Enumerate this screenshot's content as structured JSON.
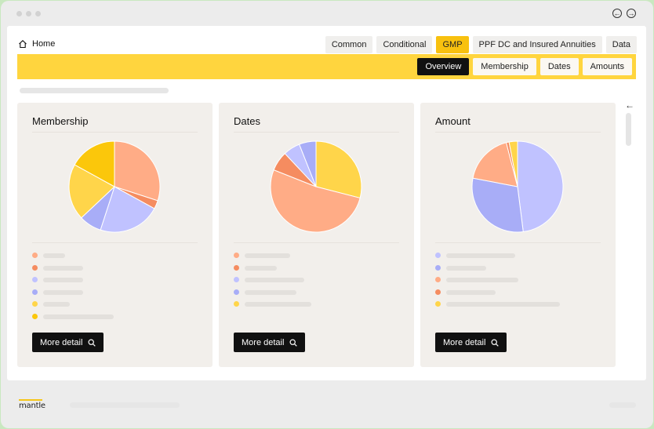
{
  "home": {
    "label": "Home"
  },
  "tabs": [
    {
      "label": "Common",
      "active": false
    },
    {
      "label": "Conditional",
      "active": false
    },
    {
      "label": "GMP",
      "active": true
    },
    {
      "label": "PPF DC and Insured Annuities",
      "active": false
    },
    {
      "label": "Data",
      "active": false
    }
  ],
  "subtabs": [
    {
      "label": "Overview",
      "active": true
    },
    {
      "label": "Membership",
      "active": false
    },
    {
      "label": "Dates",
      "active": false
    },
    {
      "label": "Amounts",
      "active": false
    }
  ],
  "colors": {
    "accent_yellow": "#ffd53e",
    "active_tab": "#f8c10f",
    "salmon": "#ffac86",
    "orange": "#f58c60",
    "lavender": "#c0c2ff",
    "periwinkle": "#a8adf7",
    "yellow": "#ffd54a",
    "gold": "#fbc70b"
  },
  "cards": [
    {
      "title": "Membership",
      "button_label": "More detail",
      "slices": [
        {
          "color": "#ffac86",
          "value": 30
        },
        {
          "color": "#f58c60",
          "value": 3
        },
        {
          "color": "#c0c2ff",
          "value": 22
        },
        {
          "color": "#a8adf7",
          "value": 8
        },
        {
          "color": "#ffd54a",
          "value": 20
        },
        {
          "color": "#fbc70b",
          "value": 17
        }
      ],
      "legend": [
        {
          "color": "#ffac86"
        },
        {
          "color": "#f58c60"
        },
        {
          "color": "#c0c2ff"
        },
        {
          "color": "#a8adf7"
        },
        {
          "color": "#ffd54a"
        },
        {
          "color": "#fbc70b"
        }
      ]
    },
    {
      "title": "Dates",
      "button_label": "More detail",
      "slices": [
        {
          "color": "#ffd54a",
          "value": 29
        },
        {
          "color": "#ffac86",
          "value": 52
        },
        {
          "color": "#f58c60",
          "value": 7
        },
        {
          "color": "#c0c2ff",
          "value": 6
        },
        {
          "color": "#a8adf7",
          "value": 6
        }
      ],
      "legend": [
        {
          "color": "#ffac86"
        },
        {
          "color": "#f58c60"
        },
        {
          "color": "#c0c2ff"
        },
        {
          "color": "#a8adf7"
        },
        {
          "color": "#ffd54a"
        }
      ]
    },
    {
      "title": "Amount",
      "button_label": "More detail",
      "slices": [
        {
          "color": "#c0c2ff",
          "value": 48
        },
        {
          "color": "#a8adf7",
          "value": 30
        },
        {
          "color": "#ffac86",
          "value": 18
        },
        {
          "color": "#f58c60",
          "value": 1
        },
        {
          "color": "#ffd54a",
          "value": 3
        }
      ],
      "legend": [
        {
          "color": "#c0c2ff"
        },
        {
          "color": "#a8adf7"
        },
        {
          "color": "#ffac86"
        },
        {
          "color": "#f58c60"
        },
        {
          "color": "#ffd54a"
        }
      ]
    }
  ],
  "footer": {
    "logo": "mantle"
  }
}
